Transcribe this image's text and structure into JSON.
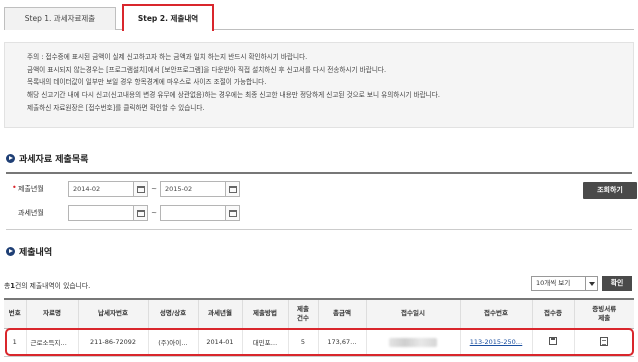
{
  "tabs": [
    {
      "label": "Step 1. 과세자료제출"
    },
    {
      "label": "Step 2. 제출내역"
    }
  ],
  "notice": [
    "주의 : 접수증에 표시된 금액이 실제 신고하고자 하는 금액과 일치 하는지 반드시 확인하시기 바랍니다.",
    "금액이 표시되지 않는경우는 [프로그램설치]에서 [보안프로그램]을 다운받아 직접 설치하신 후 신고서를 다시 전송하시기 바랍니다.",
    "목록내의 데이터값이 일부만 보일 경우 항목경계에 마우스로 사이즈 조절이 가능합니다.",
    "해당 신고기간 내에 다시 신고(신고내용의 변경 유무에 상관없음)하는 경우에는 최종 신고한 내용만 정당하게 신고된 것으로 보니 유의하시기 바랍니다.",
    "제출하신 자료원장은 [접수번호]를 클릭하면 확인할 수 있습니다."
  ],
  "search": {
    "section_title": "과세자료 제출목록",
    "submit_label": "제출년월",
    "tax_label": "과세년월",
    "submit_from": "2014-02",
    "submit_to": "2015-02",
    "tax_from": "",
    "tax_to": "",
    "tilde": "~",
    "query_button": "조회하기"
  },
  "results": {
    "section_title": "제출내역",
    "summary_count": "1",
    "summary_text": "건의 제출내역이 있습니다.",
    "page_size": "10개씩 보기",
    "confirm_button": "확인",
    "columns": [
      "번호",
      "자료명",
      "납세자번호",
      "성명/상호",
      "과세년월",
      "제출방법",
      "제출\n건수",
      "총금액",
      "접수일시",
      "접수번호",
      "접수증",
      "증빙서류\n제출"
    ],
    "rows": [
      {
        "no": "1",
        "name": "근로소득지…",
        "taxpayer_no": "211-86-72092",
        "company": "(주)아이…",
        "tax_month": "2014-01",
        "method": "대민포…",
        "count": "5",
        "total": "173,67…",
        "receipt_date": "",
        "receipt_no": "113-2015-250…"
      }
    ]
  },
  "colors": {
    "accent_red": "#d9262c",
    "bullet_navy": "#1f3f75",
    "button_dark": "#4a4a4a",
    "link_blue": "#1a4fa0"
  }
}
